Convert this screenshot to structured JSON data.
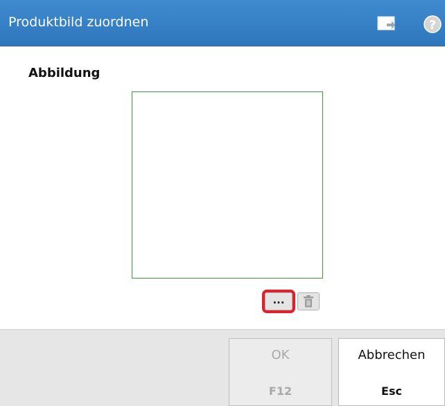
{
  "window": {
    "title": "Produktbild zuordnen",
    "icons": [
      "window-detach-icon",
      "help-icon"
    ],
    "help_glyph": "?"
  },
  "content": {
    "section_label": "Abbildung",
    "browse_button_label": "...",
    "delete_icon": "trash-icon"
  },
  "footer": {
    "ok": {
      "label": "OK",
      "shortcut": "F12",
      "enabled": false
    },
    "cancel": {
      "label": "Abbrechen",
      "shortcut": "Esc",
      "enabled": true
    }
  },
  "colors": {
    "titlebar": "#3580c5",
    "image_frame_border": "#3a9a3a",
    "highlight": "#e0202a"
  }
}
